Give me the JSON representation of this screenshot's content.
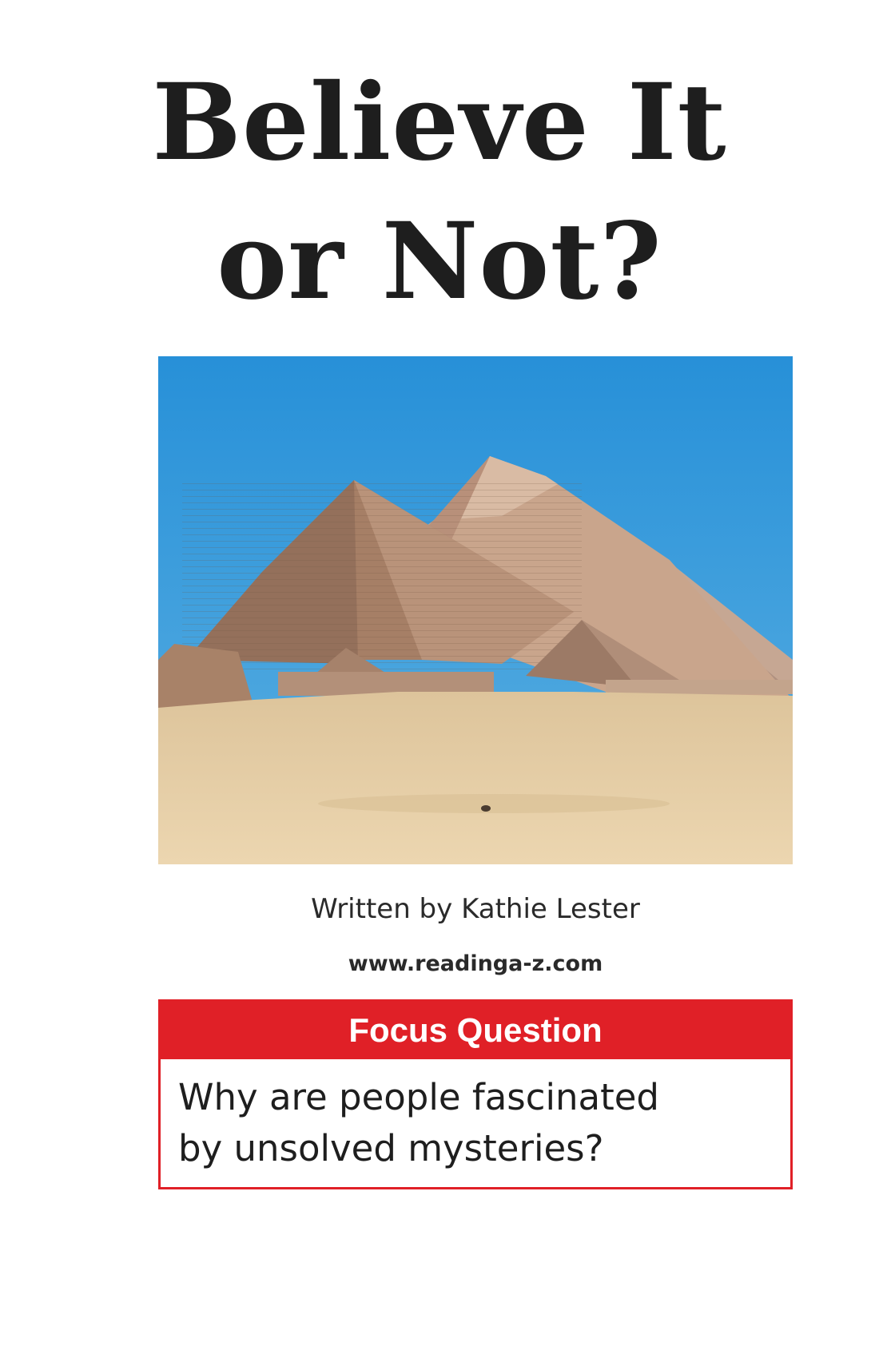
{
  "cover": {
    "title_line1": "Believe It",
    "title_line2": "or Not?",
    "photo_subject": "pyramids-of-giza",
    "byline": "Written by Kathie Lester",
    "website": "www.readinga-z.com"
  },
  "focus": {
    "heading": "Focus Question",
    "question_line1": "Why are people fascinated",
    "question_line2": "by unsolved mysteries?"
  },
  "colors": {
    "accent_red": "#e02027",
    "title_text": "#1e1e1e",
    "sky": "#2f8fd4",
    "sand": "#e2c9a0"
  }
}
